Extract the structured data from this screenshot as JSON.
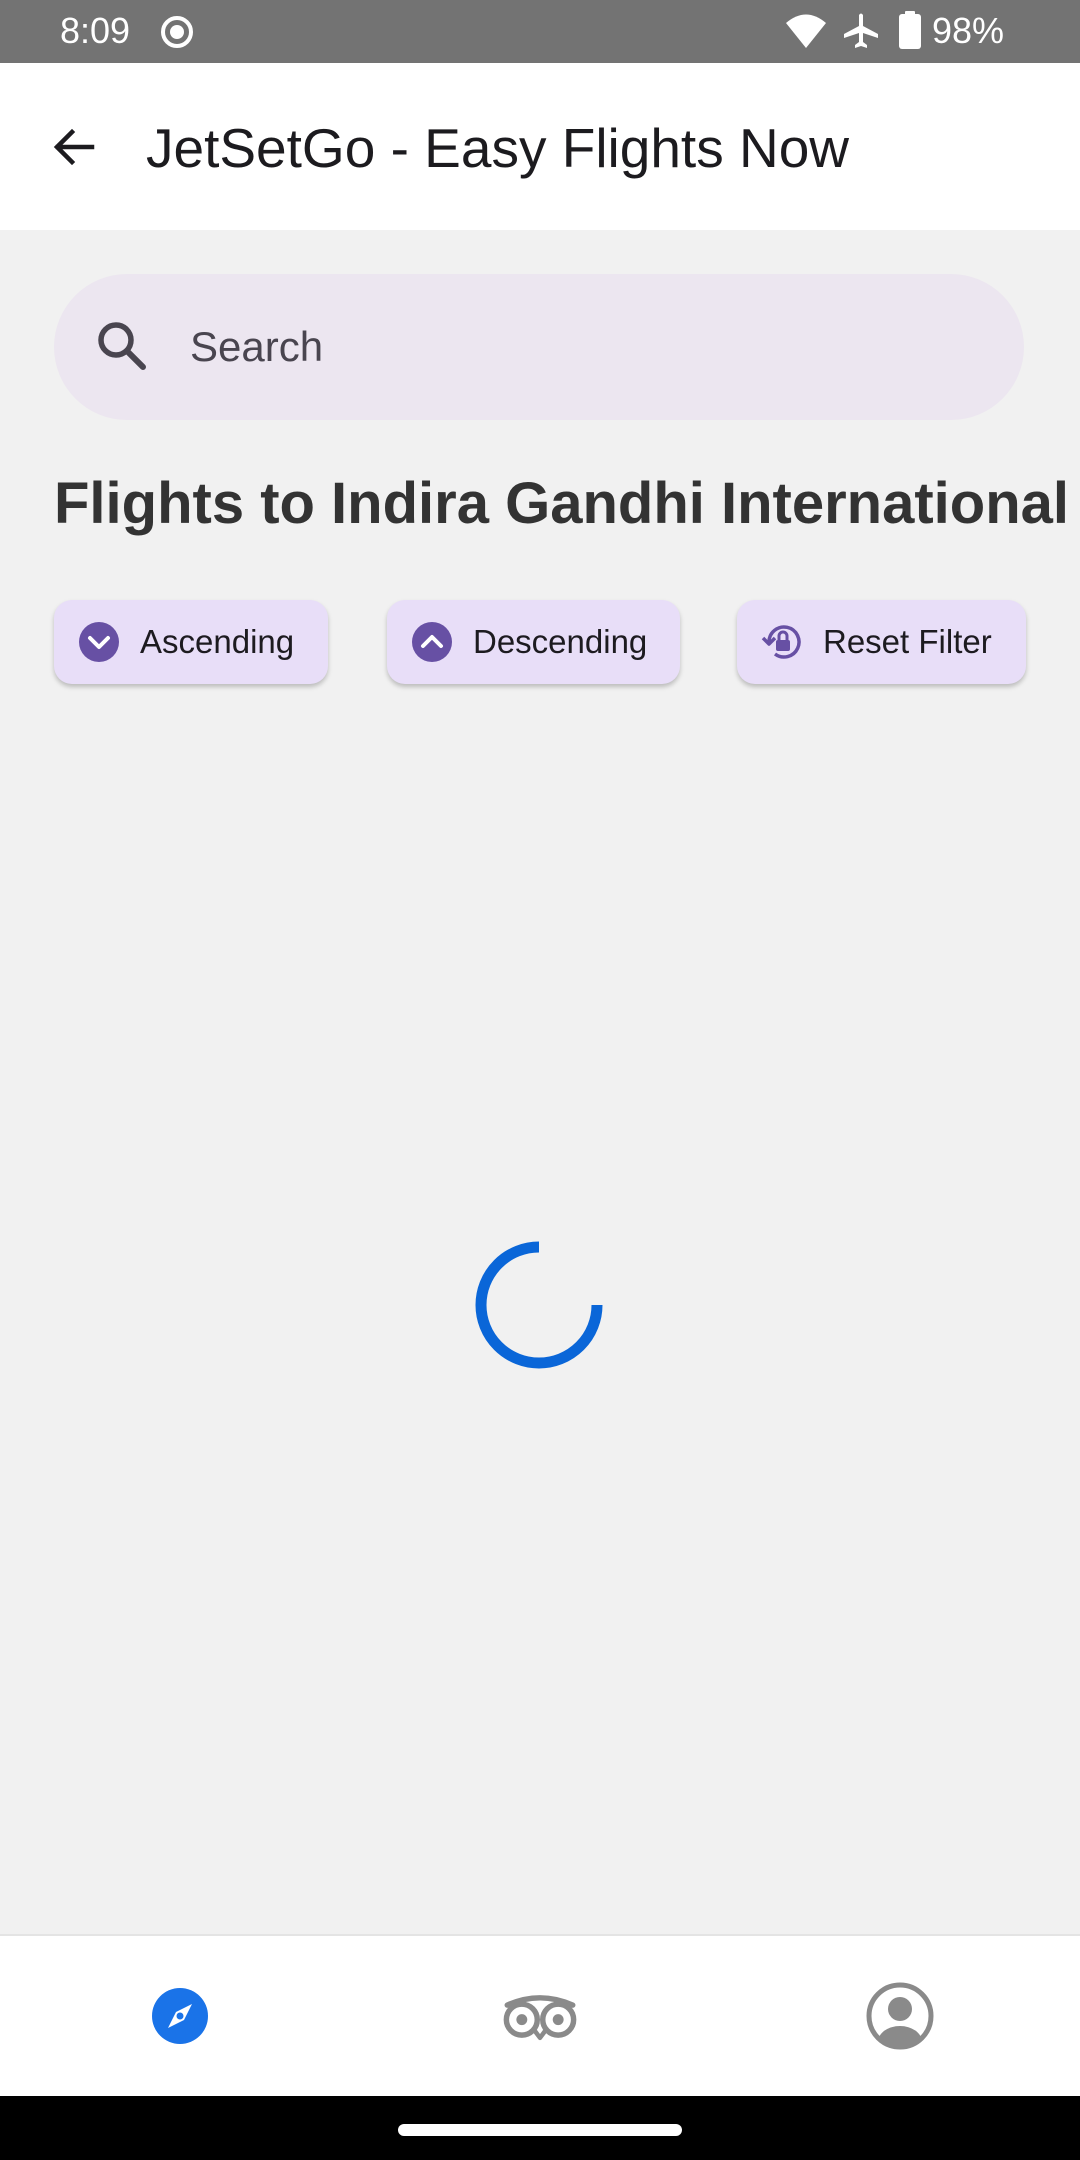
{
  "status_bar": {
    "time": "8:09",
    "battery": "98%",
    "icons": [
      "screen-record-icon",
      "wifi-icon",
      "airplane-mode-icon",
      "battery-icon"
    ]
  },
  "app_bar": {
    "title": "JetSetGo - Easy Flights Now",
    "back_icon": "arrow-back-icon"
  },
  "search": {
    "placeholder": "Search",
    "value": ""
  },
  "heading": "Flights to Indira Gandhi International",
  "filters": {
    "ascending_label": "Ascending",
    "descending_label": "Descending",
    "reset_label": "Reset Filter"
  },
  "loading": true,
  "bottom_nav": {
    "items": [
      "explore-compass-icon",
      "tripadvisor-owl-icon",
      "profile-icon"
    ],
    "active": "explore-compass-icon"
  },
  "colors": {
    "accent": "#0a66d8",
    "chip_background": "#e8def8",
    "chip_icon": "#6750a4",
    "search_background": "#ece6f0",
    "nav_active": "#1a73e8"
  }
}
